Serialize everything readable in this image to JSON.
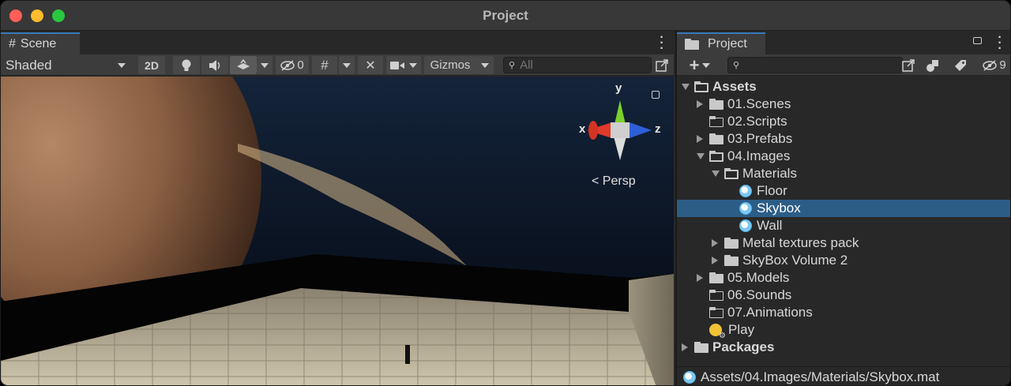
{
  "window": {
    "title": "Project"
  },
  "scene": {
    "tab_label": "Scene",
    "toolbar": {
      "shading_mode": "Shaded",
      "mode_2d": "2D",
      "hidden_count": "0",
      "gizmos_label": "Gizmos",
      "search_placeholder": "All"
    },
    "gizmo": {
      "x": "x",
      "y": "y",
      "z": "z",
      "projection": "Persp"
    }
  },
  "project": {
    "tab_label": "Project",
    "hidden_count": "9",
    "tree": [
      {
        "label": "Assets",
        "depth": 0,
        "expand": "open",
        "icon": "folder-open",
        "bold": true
      },
      {
        "label": "01.Scenes",
        "depth": 1,
        "expand": "closed",
        "icon": "folder"
      },
      {
        "label": "02.Scripts",
        "depth": 1,
        "expand": "none",
        "icon": "folder-empty"
      },
      {
        "label": "03.Prefabs",
        "depth": 1,
        "expand": "closed",
        "icon": "folder"
      },
      {
        "label": "04.Images",
        "depth": 1,
        "expand": "open",
        "icon": "folder-open"
      },
      {
        "label": "Materials",
        "depth": 2,
        "expand": "open",
        "icon": "folder-open"
      },
      {
        "label": "Floor",
        "depth": 3,
        "expand": "none",
        "icon": "material"
      },
      {
        "label": "Skybox",
        "depth": 3,
        "expand": "none",
        "icon": "material",
        "selected": true
      },
      {
        "label": "Wall",
        "depth": 3,
        "expand": "none",
        "icon": "material"
      },
      {
        "label": "Metal textures pack",
        "depth": 2,
        "expand": "closed",
        "icon": "folder"
      },
      {
        "label": "SkyBox Volume 2",
        "depth": 2,
        "expand": "closed",
        "icon": "folder"
      },
      {
        "label": "05.Models",
        "depth": 1,
        "expand": "closed",
        "icon": "folder"
      },
      {
        "label": "06.Sounds",
        "depth": 1,
        "expand": "none",
        "icon": "folder-empty"
      },
      {
        "label": "07.Animations",
        "depth": 1,
        "expand": "none",
        "icon": "folder-empty"
      },
      {
        "label": "Play",
        "depth": 1,
        "expand": "none",
        "icon": "scene-settings"
      },
      {
        "label": "Packages",
        "depth": 0,
        "expand": "closed",
        "icon": "folder",
        "bold": true
      }
    ],
    "status_path": "Assets/04.Images/Materials/Skybox.mat"
  },
  "colors": {
    "selection": "#2c5d87",
    "tab_accent": "#3a79bb",
    "panel_bg": "#282828",
    "toolbar_bg": "#3c3c3c"
  }
}
